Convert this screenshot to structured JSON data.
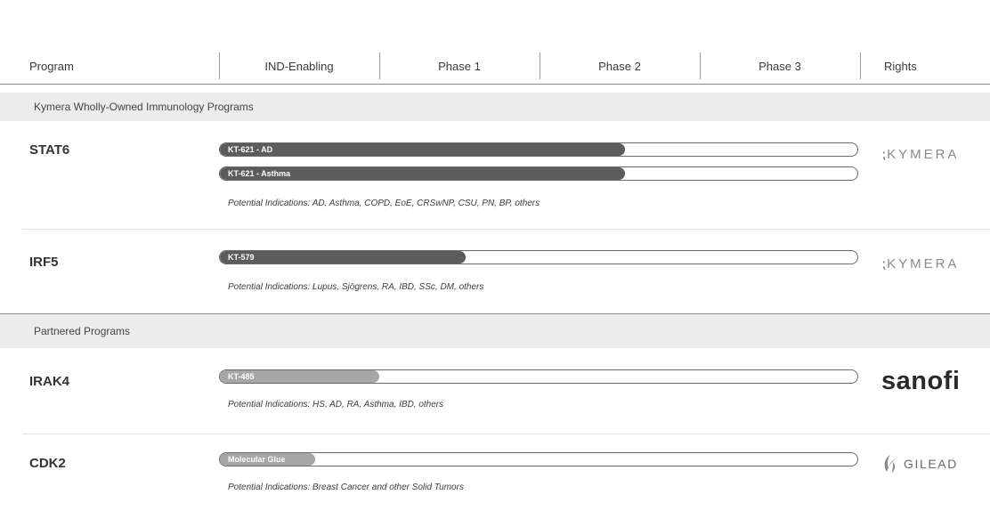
{
  "header": {
    "program": "Program",
    "ind_enabling": "IND-Enabling",
    "phase1": "Phase 1",
    "phase2": "Phase 2",
    "phase3": "Phase 3",
    "rights": "Rights"
  },
  "sections": {
    "wholly_owned": "Kymera Wholly-Owned Immunology Programs",
    "partnered": "Partnered Programs"
  },
  "programs": [
    {
      "target": "STAT6",
      "bars": [
        {
          "label": "KT-621 - AD",
          "progress": 0.635,
          "shade": "dark"
        },
        {
          "label": "KT-621 - Asthma",
          "progress": 0.635,
          "shade": "dark"
        }
      ],
      "indications": "Potential Indications: AD, Asthma, COPD, EoE, CRSwNP, CSU, PN, BP, others",
      "rights": "KYMERA"
    },
    {
      "target": "IRF5",
      "bars": [
        {
          "label": "KT-579",
          "progress": 0.385,
          "shade": "dark"
        }
      ],
      "indications": "Potential Indications: Lupus, Sjögrens, RA, IBD, SSc, DM, others",
      "rights": "KYMERA"
    },
    {
      "target": "IRAK4",
      "bars": [
        {
          "label": "KT-485",
          "progress": 0.25,
          "shade": "light"
        }
      ],
      "indications": "Potential Indications: HS, AD, RA, Asthma, IBD, others",
      "rights": "sanofi"
    },
    {
      "target": "CDK2",
      "bars": [
        {
          "label": "Molecular Glue",
          "progress": 0.15,
          "shade": "light"
        }
      ],
      "indications": "Potential Indications: Breast Cancer and other Solid Tumors",
      "rights": "GILEAD"
    }
  ],
  "icons": {
    "kymera_mark": "kymera-bracket-icon",
    "gilead_mark": "gilead-leaf-icon"
  },
  "colors": {
    "dark_bar": "#5c5c5c",
    "light_bar": "#a6a6a6",
    "section_bg": "#ececec"
  }
}
